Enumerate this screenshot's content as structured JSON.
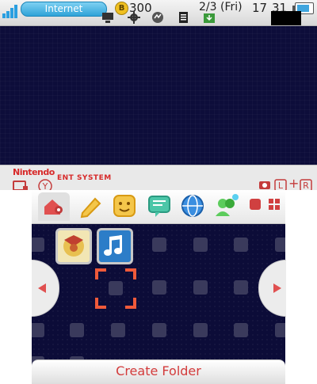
{
  "status_bar": {
    "connection_label": "Internet",
    "coin_symbol": "B",
    "coin_count": "300",
    "date": "2/3 (Fri)",
    "time_hours": "17",
    "time_minutes": "31"
  },
  "top_footer": {
    "brand": "Nintendo",
    "system_label": "ENT SYSTEM",
    "l_label": "L",
    "plus_label": "+",
    "r_label": "R",
    "y_label": "Y"
  },
  "toolbar": {
    "icons": [
      "settings-icon",
      "pencil-icon",
      "mii-face-icon",
      "notifications-icon",
      "internet-browser-icon",
      "miiverse-icon",
      "record-icon",
      "grid-view-icon"
    ]
  },
  "home_grid": {
    "apps": [
      {
        "name": "pokemon-app-icon"
      },
      {
        "name": "music-app-icon"
      },
      {
        "name": "folder-icon"
      }
    ]
  },
  "bottom_bar": {
    "create_folder_label": "Create Folder"
  },
  "colors": {
    "accent_red": "#d33b3b",
    "top_bg": "#0d0d3a",
    "internet_blue": "#2fa3d8"
  }
}
